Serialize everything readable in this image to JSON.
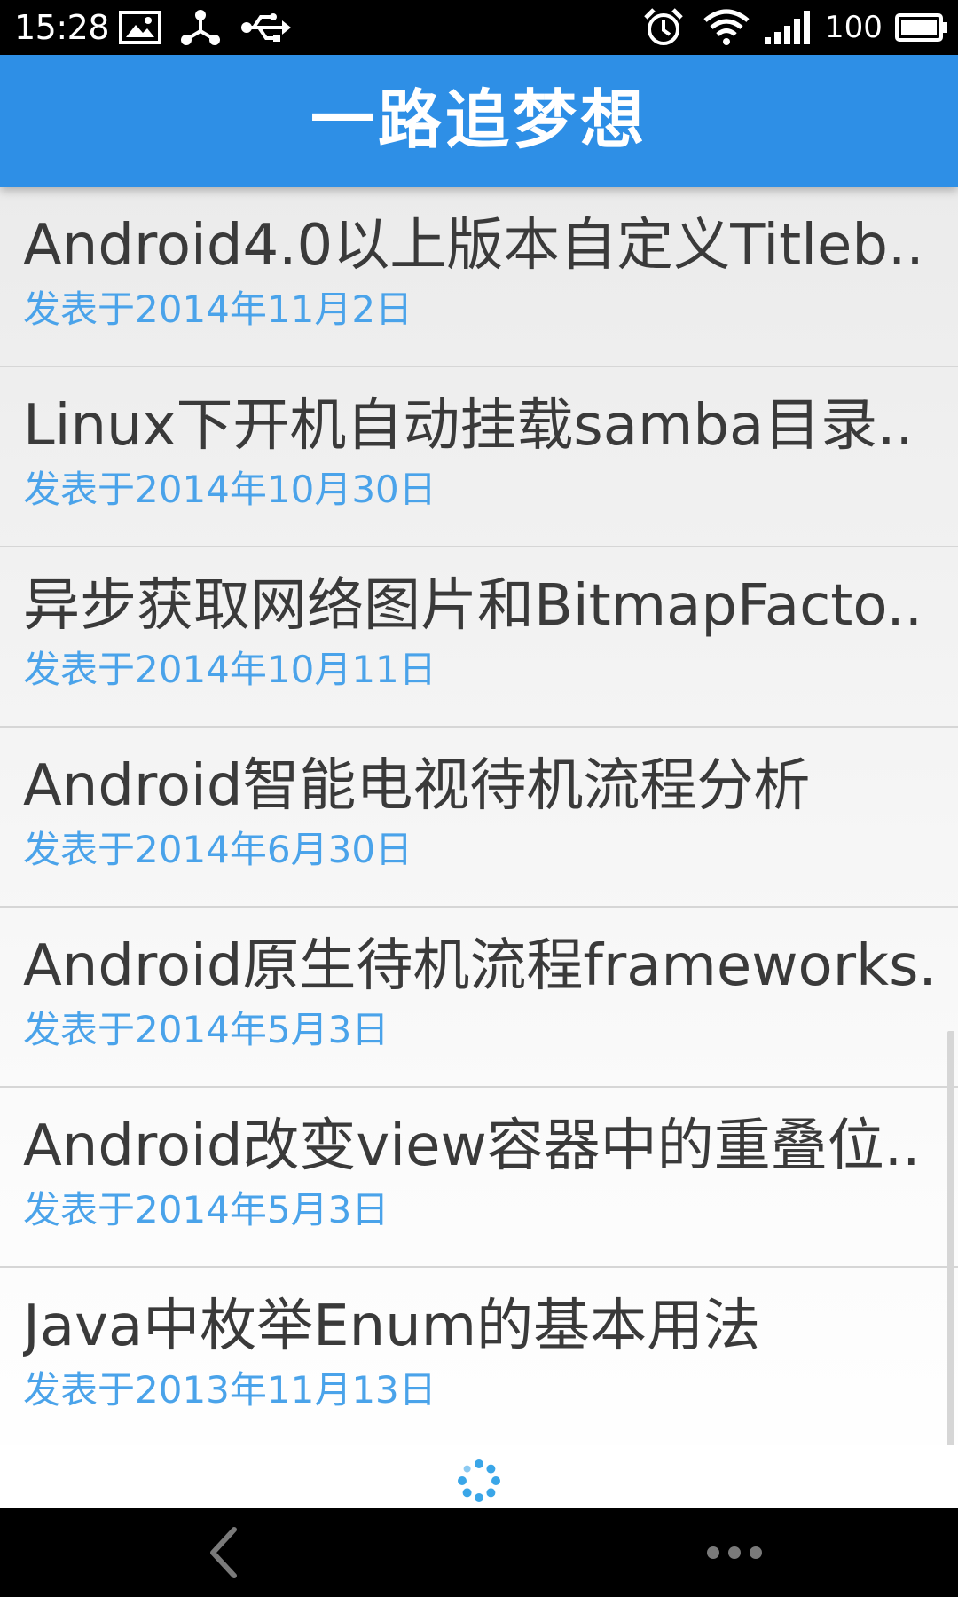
{
  "status_bar": {
    "time": "15:28",
    "battery_level": "100",
    "icons": [
      "image-icon",
      "share-icon",
      "usb-icon",
      "alarm-icon",
      "wifi-icon",
      "signal-icon",
      "battery-icon"
    ]
  },
  "app_bar": {
    "title": "一路追梦想"
  },
  "articles": [
    {
      "title": "Android4.0以上版本自定义Titleb..",
      "date": "发表于2014年11月2日"
    },
    {
      "title": "Linux下开机自动挂载samba目录..",
      "date": "发表于2014年10月30日"
    },
    {
      "title": "异步获取网络图片和BitmapFacto..",
      "date": "发表于2014年10月11日"
    },
    {
      "title": "Android智能电视待机流程分析",
      "date": "发表于2014年6月30日"
    },
    {
      "title": "Android原生待机流程frameworks..",
      "date": "发表于2014年5月3日"
    },
    {
      "title": "Android改变view容器中的重叠位..",
      "date": "发表于2014年5月3日"
    },
    {
      "title": "Java中枚举Enum的基本用法",
      "date": "发表于2013年11月13日"
    }
  ],
  "colors": {
    "app_bar": "#2e8fe6",
    "date_text": "#4aa3ea",
    "title_text": "#3a3a3a",
    "divider": "#d6d6d6",
    "spinner": "#3aa6e8"
  },
  "navigation": {
    "icons": [
      "back-icon",
      "more-icon"
    ]
  }
}
